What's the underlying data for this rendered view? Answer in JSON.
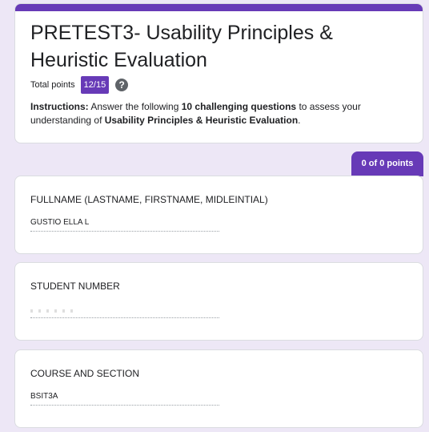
{
  "header": {
    "title": "PRETEST3- Usability Principles & Heuristic Evaluation",
    "total_points_label": "Total points",
    "score": "12/15",
    "help_icon": "help-circle-icon",
    "instructions": {
      "prefix": "Instructions:",
      "part1": " Answer the following ",
      "emphasis1": "10 challenging questions",
      "part2": " to assess your understanding of ",
      "emphasis2": "Usability Principles & Heuristic Evaluation",
      "suffix": "."
    }
  },
  "section": {
    "points_tab": "0 of 0 points"
  },
  "questions": [
    {
      "label": "FULLNAME (LASTNAME, FIRSTNAME, MIDLEINTIAL)",
      "answer": "GUSTIO ELLA L"
    },
    {
      "label": "STUDENT NUMBER",
      "answer": ""
    },
    {
      "label": "COURSE AND SECTION",
      "answer": "BSIT3A"
    }
  ],
  "colors": {
    "accent": "#673ab7",
    "page_background": "#ede7f6",
    "card_background": "#ffffff"
  }
}
